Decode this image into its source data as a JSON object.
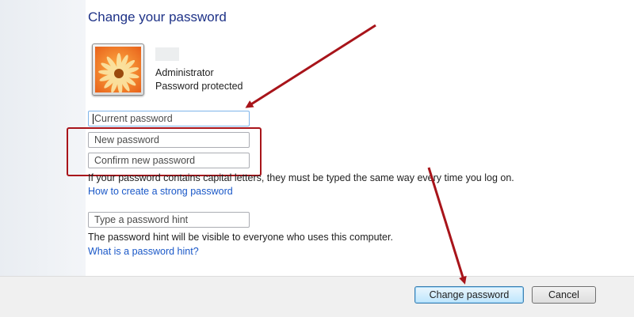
{
  "page": {
    "title": "Change your password"
  },
  "user": {
    "role": "Administrator",
    "status": "Password protected",
    "avatar_icon": "flower-avatar-icon"
  },
  "form": {
    "current_password_placeholder": "Current password",
    "new_password_placeholder": "New password",
    "confirm_password_placeholder": "Confirm new password",
    "capital_letters_note": "If your password contains capital letters, they must be typed the same way every time you log on.",
    "strong_password_link": "How to create a strong password",
    "hint_placeholder": "Type a password hint",
    "hint_note": "The password hint will be visible to everyone who uses this computer.",
    "hint_link": "What is a password hint?"
  },
  "buttons": {
    "change_password": "Change password",
    "cancel": "Cancel"
  },
  "annotations": {
    "color": "#a8141a"
  }
}
